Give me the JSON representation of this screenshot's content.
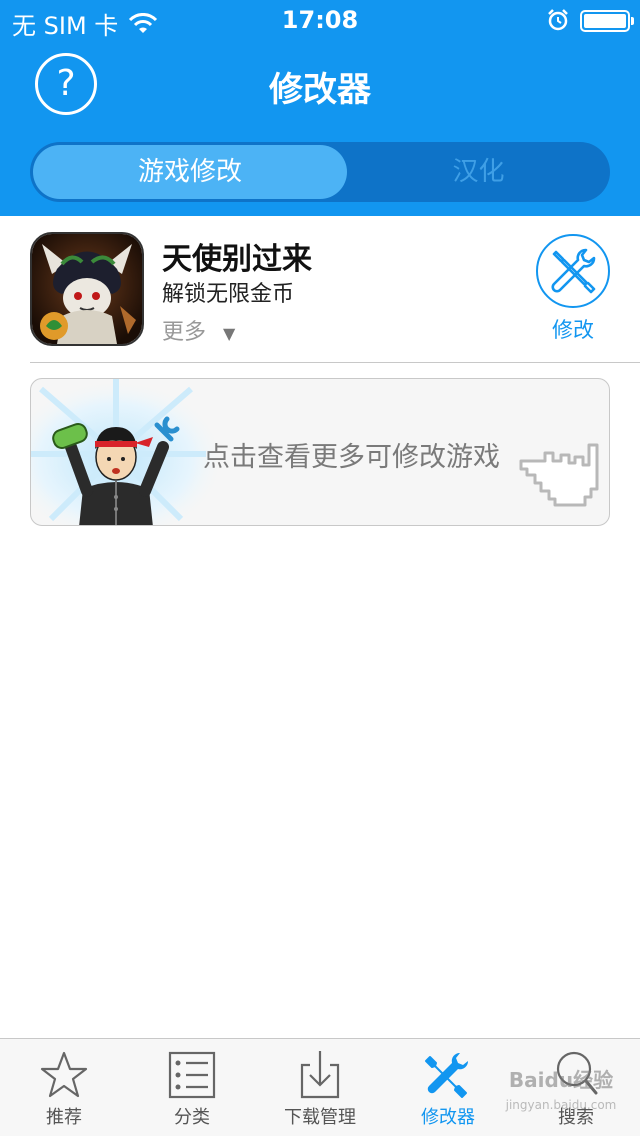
{
  "status_bar": {
    "carrier": "无 SIM 卡",
    "time": "17:08"
  },
  "nav": {
    "help_icon": "question-icon",
    "title": "修改器"
  },
  "segment": {
    "tabs": [
      {
        "label": "游戏修改",
        "selected": true
      },
      {
        "label": "汉化",
        "selected": false
      }
    ]
  },
  "game": {
    "name": "天使别过来",
    "description": "解锁无限金币",
    "more_label": "更多",
    "more_arrow": "▼",
    "action_label": "修改",
    "action_icon": "wrench-screwdriver-icon"
  },
  "banner": {
    "text": "点击查看更多可修改游戏"
  },
  "tabbar": {
    "items": [
      {
        "label": "推荐",
        "icon": "star-icon",
        "active": false
      },
      {
        "label": "分类",
        "icon": "list-icon",
        "active": false
      },
      {
        "label": "下载管理",
        "icon": "download-icon",
        "active": false
      },
      {
        "label": "修改器",
        "icon": "tools-icon",
        "active": true
      },
      {
        "label": "搜索",
        "icon": "search-icon",
        "active": false
      }
    ]
  },
  "watermark": {
    "brand": "Baidu经验",
    "url": "jingyan.baidu.com"
  },
  "colors": {
    "accent": "#1296f0",
    "segment_bg": "#0e73c8",
    "segment_active": "#4cb3f5"
  }
}
